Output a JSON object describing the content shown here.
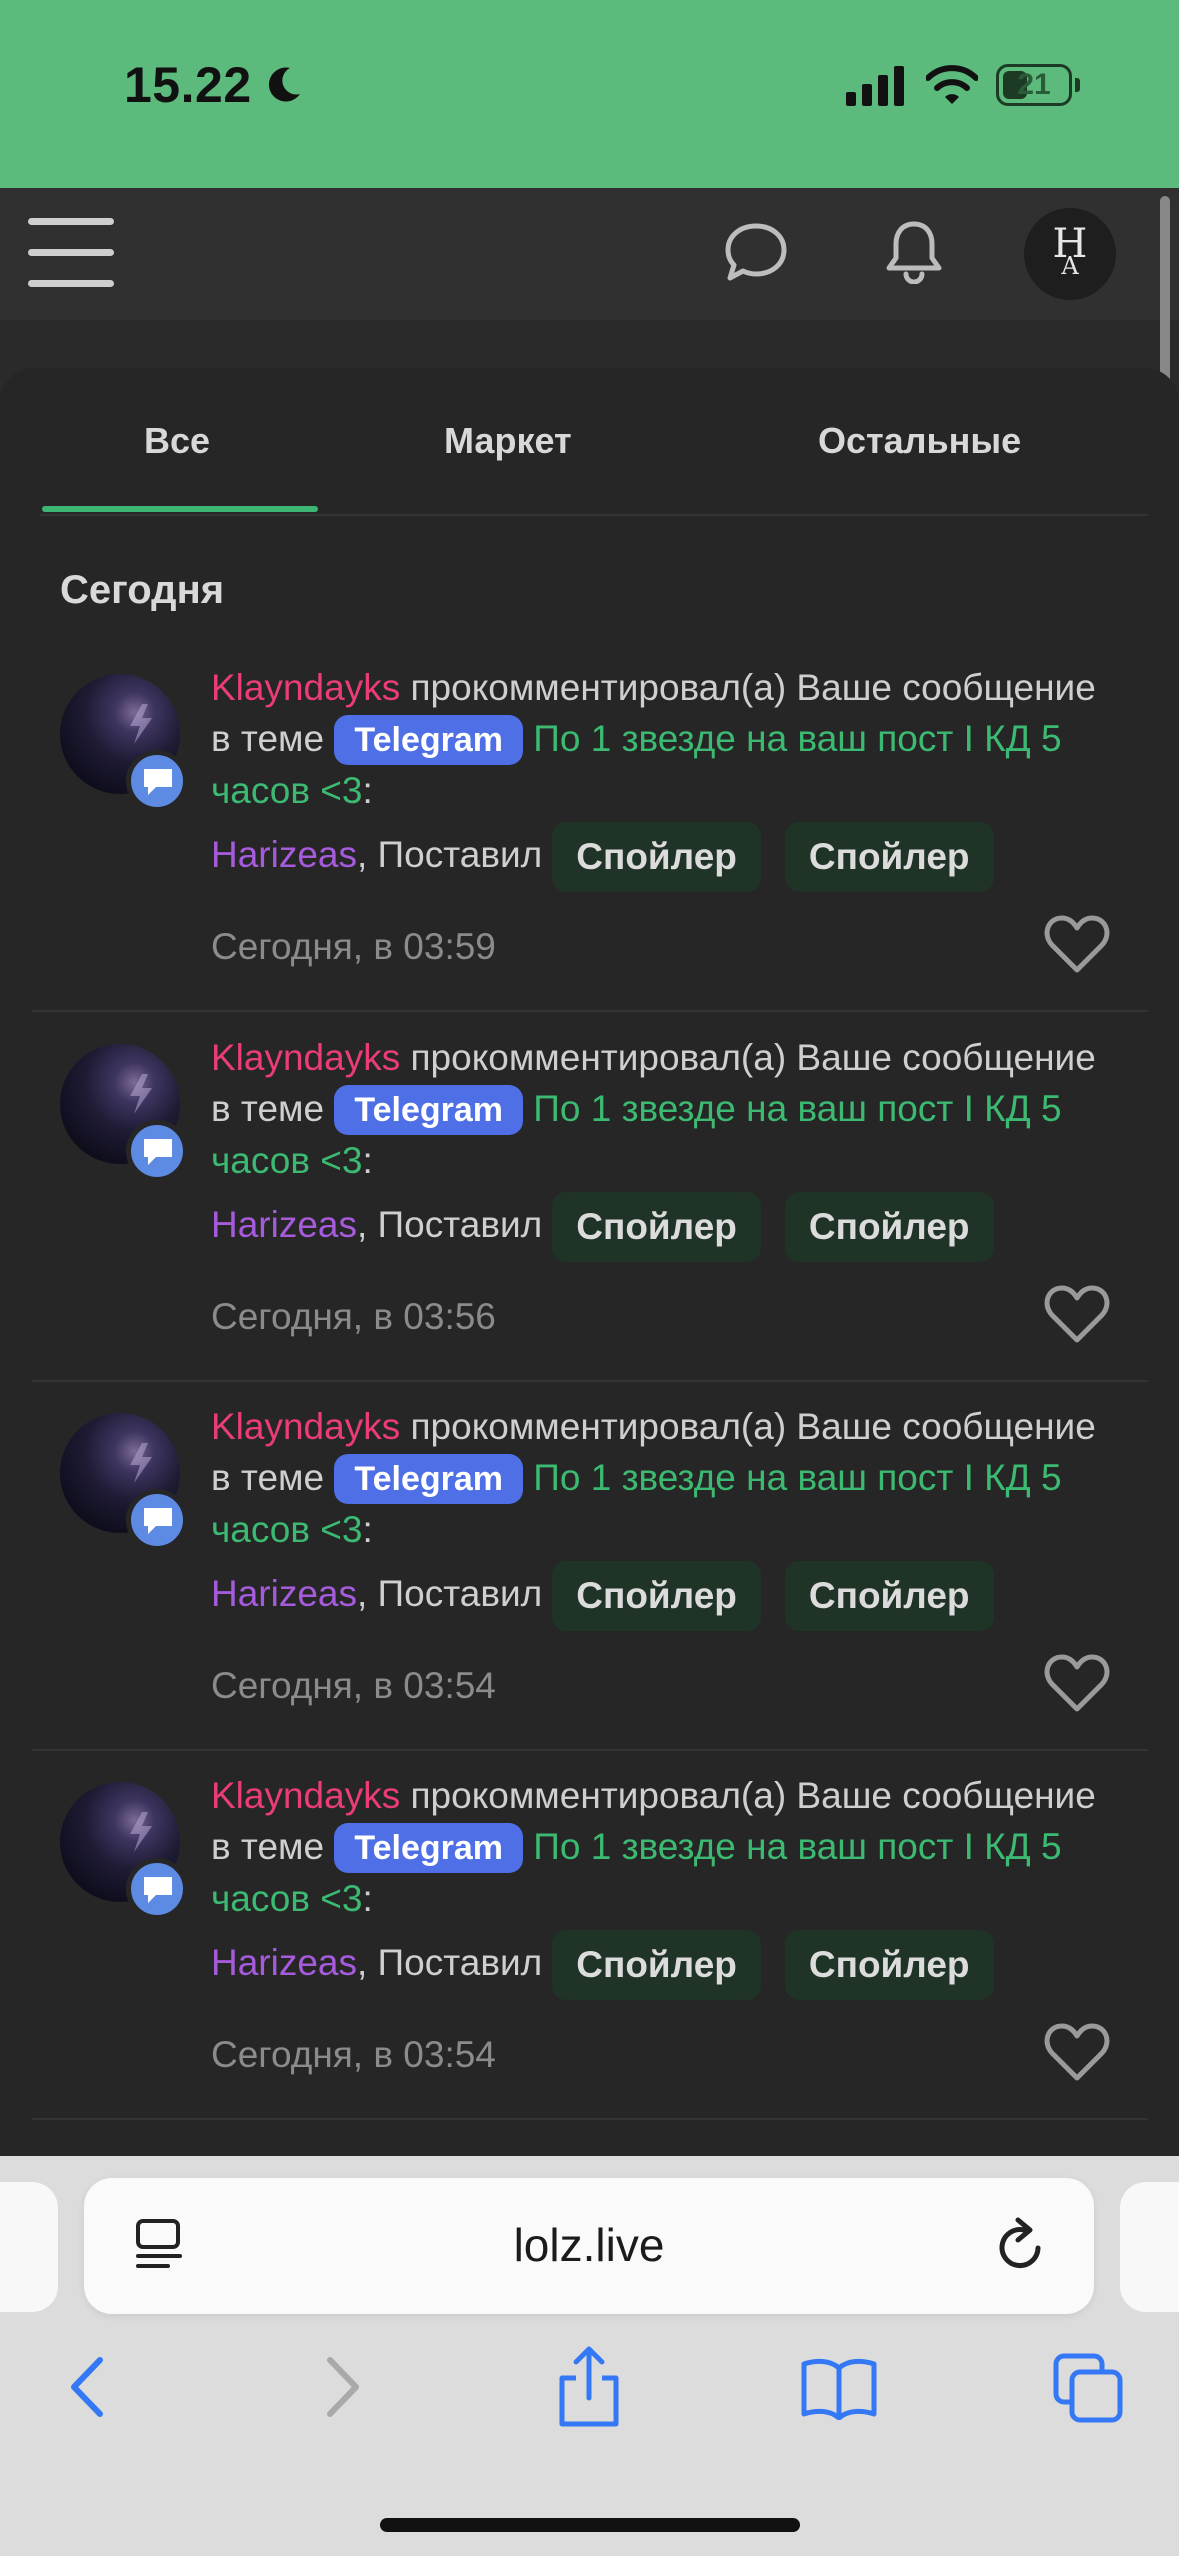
{
  "status_bar": {
    "time": "15.22",
    "battery": "21"
  },
  "tabs": [
    {
      "label": "Все",
      "active": true
    },
    {
      "label": "Маркет",
      "active": false
    },
    {
      "label": "Остальные",
      "active": false
    }
  ],
  "section_title": "Сегодня",
  "notifications": [
    {
      "user": "Klayndayks",
      "action": "прокомментировал(а) Ваше сообщение в теме",
      "tag": "Telegram",
      "thread": "По 1 звезде на ваш пост I КД 5 часов <3",
      "colon": ":",
      "commenter": "Harizeas",
      "comment": ", Поставил",
      "spoiler1": "Спойлер",
      "spoiler2": "Спойлер",
      "time": "Сегодня, в 03:59"
    },
    {
      "user": "Klayndayks",
      "action": "прокомментировал(а) Ваше сообщение в теме",
      "tag": "Telegram",
      "thread": "По 1 звезде на ваш пост I КД 5 часов <3",
      "colon": ":",
      "commenter": "Harizeas",
      "comment": ", Поставил",
      "spoiler1": "Спойлер",
      "spoiler2": "Спойлер",
      "time": "Сегодня, в 03:56"
    },
    {
      "user": "Klayndayks",
      "action": "прокомментировал(а) Ваше сообщение в теме",
      "tag": "Telegram",
      "thread": "По 1 звезде на ваш пост I КД 5 часов <3",
      "colon": ":",
      "commenter": "Harizeas",
      "comment": ", Поставил",
      "spoiler1": "Спойлер",
      "spoiler2": "Спойлер",
      "time": "Сегодня, в 03:54"
    },
    {
      "user": "Klayndayks",
      "action": "прокомментировал(а) Ваше сообщение в теме",
      "tag": "Telegram",
      "thread": "По 1 звезде на ваш пост I КД 5 часов <3",
      "colon": ":",
      "commenter": "Harizeas",
      "comment": ", Поставил",
      "spoiler1": "Спойлер",
      "spoiler2": "Спойлер",
      "time": "Сегодня, в 03:54"
    }
  ],
  "browser": {
    "url": "lolz.live"
  },
  "icons": {
    "menu": "menu-icon",
    "chat": "chat-bubble-icon",
    "bell": "bell-icon",
    "avatar": "user-avatar",
    "badge": "comment-badge-icon",
    "heart": "heart-icon",
    "page": "page-menu-icon",
    "reload": "reload-icon",
    "back": "back-icon",
    "forward": "forward-icon",
    "share": "share-icon",
    "bookmarks": "bookmarks-icon",
    "tabs": "tabs-icon"
  },
  "colors": {
    "status_bar": "#5cba7d",
    "accent_green": "#3db673",
    "user_pink": "#ea3d78",
    "user_purple": "#a55bdc",
    "tag_blue": "#4f6fe6"
  }
}
